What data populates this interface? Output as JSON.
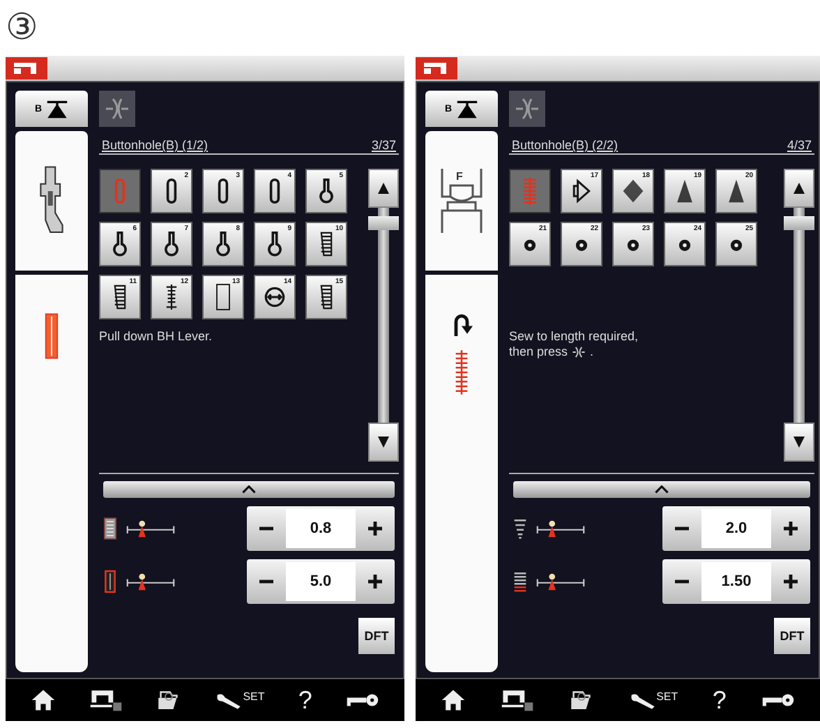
{
  "step_marker": "③",
  "screens": [
    {
      "foot_letter": "B",
      "foot": {
        "kind": "side"
      },
      "stitch_panel": {
        "kind": "buttonhole",
        "reverse_arrow": false
      },
      "title": "Buttonhole(B) (1/2)",
      "page": "3/37",
      "patterns": [
        {
          "kind": "slot",
          "selected": true
        },
        {
          "number": "2",
          "kind": "slot",
          "selected": false
        },
        {
          "number": "3",
          "kind": "slot",
          "selected": false
        },
        {
          "number": "4",
          "kind": "slot",
          "selected": false
        },
        {
          "number": "5",
          "kind": "keyhole",
          "selected": false
        },
        {
          "number": "6",
          "kind": "keyhole",
          "selected": false
        },
        {
          "number": "7",
          "kind": "keyhole",
          "selected": false
        },
        {
          "number": "8",
          "kind": "keyhole",
          "selected": false
        },
        {
          "number": "9",
          "kind": "keyhole",
          "selected": false
        },
        {
          "number": "10",
          "kind": "stretch",
          "selected": false
        },
        {
          "number": "11",
          "kind": "stretch",
          "selected": false
        },
        {
          "number": "12",
          "kind": "ladder",
          "selected": false
        },
        {
          "number": "13",
          "kind": "bound",
          "selected": false
        },
        {
          "number": "14",
          "kind": "round",
          "selected": false
        },
        {
          "number": "15",
          "kind": "stretch",
          "selected": false
        }
      ],
      "message_lines": [
        "Pull down BH Lever."
      ],
      "message_icon": false,
      "settings": [
        {
          "kind": "width",
          "value": "0.8"
        },
        {
          "kind": "length",
          "value": "5.0"
        }
      ],
      "default_button": "DFT",
      "toolbar": {
        "set_label": "SET",
        "help_label": "?"
      }
    },
    {
      "foot_letter": "B",
      "foot": {
        "kind": "front",
        "label": "F"
      },
      "stitch_panel": {
        "kind": "tack",
        "reverse_arrow": true
      },
      "title": "Buttonhole(B) (2/2)",
      "page": "4/37",
      "patterns": [
        {
          "kind": "tack",
          "selected": true
        },
        {
          "number": "17",
          "kind": "arrow",
          "selected": false
        },
        {
          "number": "18",
          "kind": "diamond",
          "selected": false
        },
        {
          "number": "19",
          "kind": "triangle",
          "selected": false
        },
        {
          "number": "20",
          "kind": "triangle",
          "selected": false
        },
        {
          "number": "21",
          "kind": "eyelet",
          "selected": false
        },
        {
          "number": "22",
          "kind": "eyelet",
          "selected": false
        },
        {
          "number": "23",
          "kind": "eyelet",
          "selected": false
        },
        {
          "number": "24",
          "kind": "eyelet",
          "selected": false
        },
        {
          "number": "25",
          "kind": "eyelet",
          "selected": false
        }
      ],
      "message_lines": [
        "Sew to length required,",
        "then press"
      ],
      "message_icon": true,
      "message_tail": ".",
      "settings": [
        {
          "kind": "taper",
          "value": "2.0"
        },
        {
          "kind": "density",
          "value": "1.50"
        }
      ],
      "default_button": "DFT",
      "toolbar": {
        "set_label": "SET",
        "help_label": "?"
      }
    }
  ]
}
